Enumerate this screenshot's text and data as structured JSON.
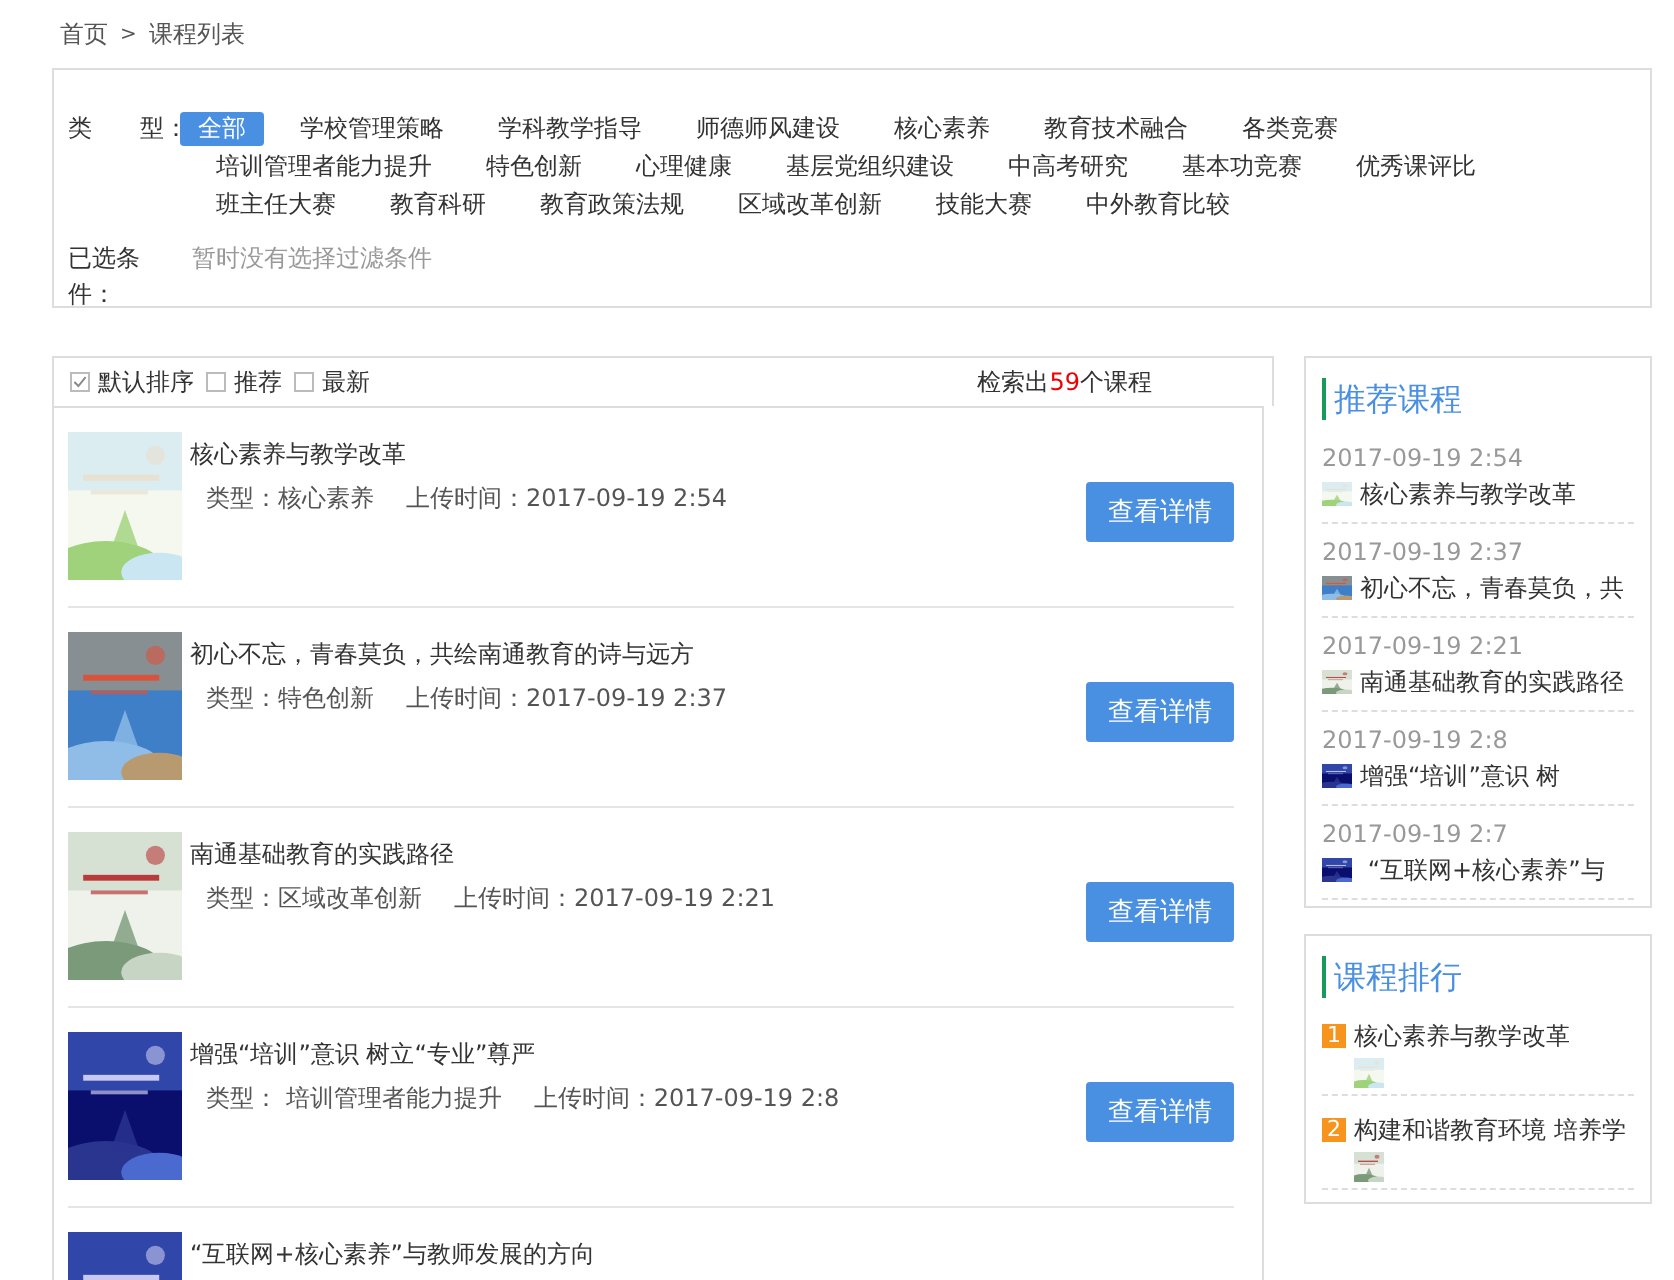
{
  "breadcrumb": {
    "home": "首页",
    "separator": ">",
    "current": "课程列表"
  },
  "filter": {
    "label": "类　　型：",
    "rows": [
      [
        {
          "label": "全部",
          "selected": true
        },
        {
          "label": "学校管理策略",
          "selected": false
        },
        {
          "label": "学科教学指导",
          "selected": false
        },
        {
          "label": "师德师风建设",
          "selected": false
        },
        {
          "label": "核心素养",
          "selected": false
        },
        {
          "label": "教育技术融合",
          "selected": false
        },
        {
          "label": "各类竞赛",
          "selected": false
        }
      ],
      [
        {
          "label": "培训管理者能力提升",
          "selected": false
        },
        {
          "label": "特色创新",
          "selected": false
        },
        {
          "label": "心理健康",
          "selected": false
        },
        {
          "label": "基层党组织建设",
          "selected": false
        },
        {
          "label": "中高考研究",
          "selected": false
        },
        {
          "label": "基本功竞赛",
          "selected": false
        },
        {
          "label": "优秀课评比",
          "selected": false
        }
      ],
      [
        {
          "label": "班主任大赛",
          "selected": false
        },
        {
          "label": "教育科研",
          "selected": false
        },
        {
          "label": "教育政策法规",
          "selected": false
        },
        {
          "label": "区域改革创新",
          "selected": false
        },
        {
          "label": "技能大赛",
          "selected": false
        },
        {
          "label": "中外教育比较",
          "selected": false
        }
      ]
    ],
    "selected_label": "已选条件：",
    "selected_value": "暂时没有选择过滤条件"
  },
  "sort": [
    {
      "label": "默认排序",
      "checked": true
    },
    {
      "label": "推荐",
      "checked": false
    },
    {
      "label": "最新",
      "checked": false
    }
  ],
  "result": {
    "prefix": "检索出",
    "count": "59",
    "suffix": "个课程"
  },
  "courses": [
    {
      "title": "核心素养与教学改革",
      "type": "类型：核心素养",
      "time": "上传时间：2017-09-19 2:54",
      "button": "查看详情"
    },
    {
      "title": "初心不忘，青春莫负，共绘南通教育的诗与远方",
      "type": "类型：特色创新",
      "time": "上传时间：2017-09-19 2:37",
      "button": "查看详情"
    },
    {
      "title": "南通基础教育的实践路径",
      "type": "类型：区域改革创新",
      "time": "上传时间：2017-09-19 2:21",
      "button": "查看详情"
    },
    {
      "title": "增强“培训”意识 树立“专业”尊严",
      "type": "类型： 培训管理者能力提升",
      "time": "上传时间：2017-09-19 2:8",
      "button": "查看详情"
    },
    {
      "title": "“互联网+核心素养”与教师发展的方向"
    }
  ],
  "recommended": {
    "title": "推荐课程",
    "items": [
      {
        "date": "2017-09-19 2:54",
        "title": "核心素养与教学改革"
      },
      {
        "date": "2017-09-19 2:37",
        "title": "初心不忘，青春莫负，共"
      },
      {
        "date": "2017-09-19 2:21",
        "title": "南通基础教育的实践路径"
      },
      {
        "date": "2017-09-19 2:8",
        "title": "增强“培训”意识 树"
      },
      {
        "date": "2017-09-19 2:7",
        "title": " “互联网+核心素养”与"
      }
    ]
  },
  "ranking": {
    "title": "课程排行",
    "items": [
      {
        "rank": "1",
        "title": "核心素养与教学改革"
      },
      {
        "rank": "2",
        "title": "构建和谐教育环境 培养学"
      }
    ]
  }
}
